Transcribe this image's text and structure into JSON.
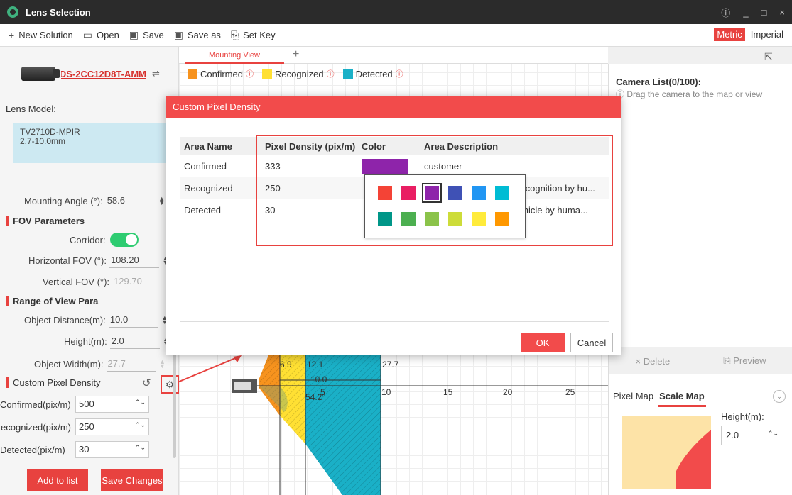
{
  "app": {
    "title": "Lens Selection"
  },
  "window": {
    "info_icon": "ⓘ",
    "minimize": "_",
    "maximize": "□",
    "close": "×"
  },
  "toolbar": {
    "new_solution": "New Solution",
    "open": "Open",
    "save": "Save",
    "save_as": "Save as",
    "set_key": "Set Key",
    "metric": "Metric",
    "imperial": "Imperial"
  },
  "left": {
    "camera_name": "DS-2CC12D8T-AMM",
    "lens_label": "Lens Model:",
    "lens_model": "TV2710D-MPIR",
    "lens_range": "2.7-10.0mm",
    "mounting_angle_label": "Mounting Angle (°):",
    "mounting_angle_value": "58.6",
    "fov_section": "FOV Parameters",
    "corridor_label": "Corridor:",
    "hfov_label": "Horizontal FOV (°):",
    "hfov_value": "108.20",
    "vfov_label": "Vertical FOV (°):",
    "vfov_value": "129.70",
    "range_section": "Range of View Para",
    "object_distance_label": "Object Distance(m):",
    "object_distance_value": "10.0",
    "height_label": "Height(m):",
    "height_value": "2.0",
    "object_width_label": "Object Width(m):",
    "object_width_value": "27.7",
    "cpd_label": "Custom Pixel Density",
    "confirmed_label": "Confirmed(pix/m)",
    "confirmed_value": "500",
    "recognized_label": "Recognized(pix/m)",
    "recognized_value": "250",
    "detected_label": "Detected(pix/m)",
    "detected_value": "30",
    "add_to_list": "Add to list",
    "save_changes": "Save Changes"
  },
  "map": {
    "tab_label": "Mounting View",
    "legend": [
      {
        "label": "Confirmed",
        "color": "#f7931e"
      },
      {
        "label": "Recognized",
        "color": "#ffe033"
      },
      {
        "label": "Detected",
        "color": "#1ab0c7"
      }
    ],
    "measure_a": "6.9",
    "measure_b": "12.1",
    "measure_c": "27.7",
    "measure_d": "10.0",
    "angle": "54.2°",
    "axis": [
      "5",
      "10",
      "15",
      "20",
      "25"
    ]
  },
  "right": {
    "camera_list_title": "Camera List(0/100):",
    "camera_list_hint": "Drag the camera to the map or view",
    "delete": "Delete",
    "preview": "Preview",
    "tab_pixel_map": "Pixel Map",
    "tab_scale_map": "Scale Map",
    "height_label": "Height(m):",
    "height_value": "2.0"
  },
  "modal": {
    "title": "Custom Pixel Density",
    "headers": [
      "Area Name",
      "Pixel Density (pix/m)",
      "Color",
      "Area Description"
    ],
    "rows": [
      {
        "name": "Confirmed",
        "density": "333",
        "color": "#8e24aa",
        "description": "customer"
      },
      {
        "name": "Recognized",
        "density": "250",
        "color": "",
        "description": "Recognition by hu..."
      },
      {
        "name": "Detected",
        "density": "30",
        "color": "",
        "description": "vehicle by huma..."
      }
    ],
    "palette": [
      "#f44336",
      "#e91e63",
      "#8e24aa",
      "#3f51b5",
      "#2196f3",
      "#00bcd4",
      "#009688",
      "#4caf50",
      "#8bc34a",
      "#cddc39",
      "#ffeb3b",
      "#ff9800"
    ],
    "ok": "OK",
    "cancel": "Cancel"
  }
}
